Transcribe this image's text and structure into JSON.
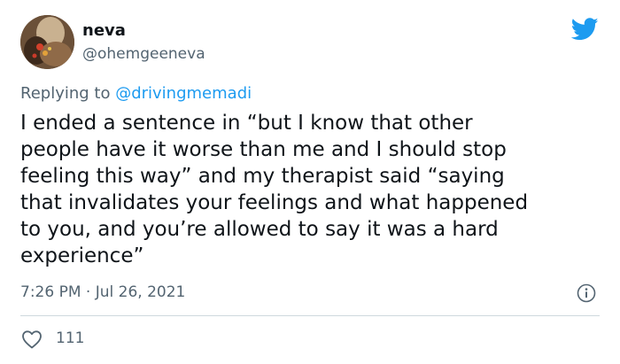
{
  "author": {
    "display_name": "neva",
    "handle": "@ohemgeeneva"
  },
  "reply": {
    "prefix": "Replying to ",
    "mention": "@drivingmemadi"
  },
  "tweet": {
    "text": "I ended a sentence in “but I know that other\npeople have it worse than me and I should stop\nfeeling this way” and my therapist said “saying\nthat invalidates your feelings and what happened\nto you, and you’re allowed to say it was a hard\nexperience”",
    "timestamp": "7:26 PM · Jul 26, 2021"
  },
  "stats": {
    "likes": "111"
  },
  "icons": {
    "brand": "twitter-bird-icon",
    "info": "info-icon",
    "like": "heart-icon"
  },
  "colors": {
    "brand": "#1d9bf0",
    "text": "#0f1419",
    "secondary": "#536471",
    "divider": "#cfd9de"
  }
}
